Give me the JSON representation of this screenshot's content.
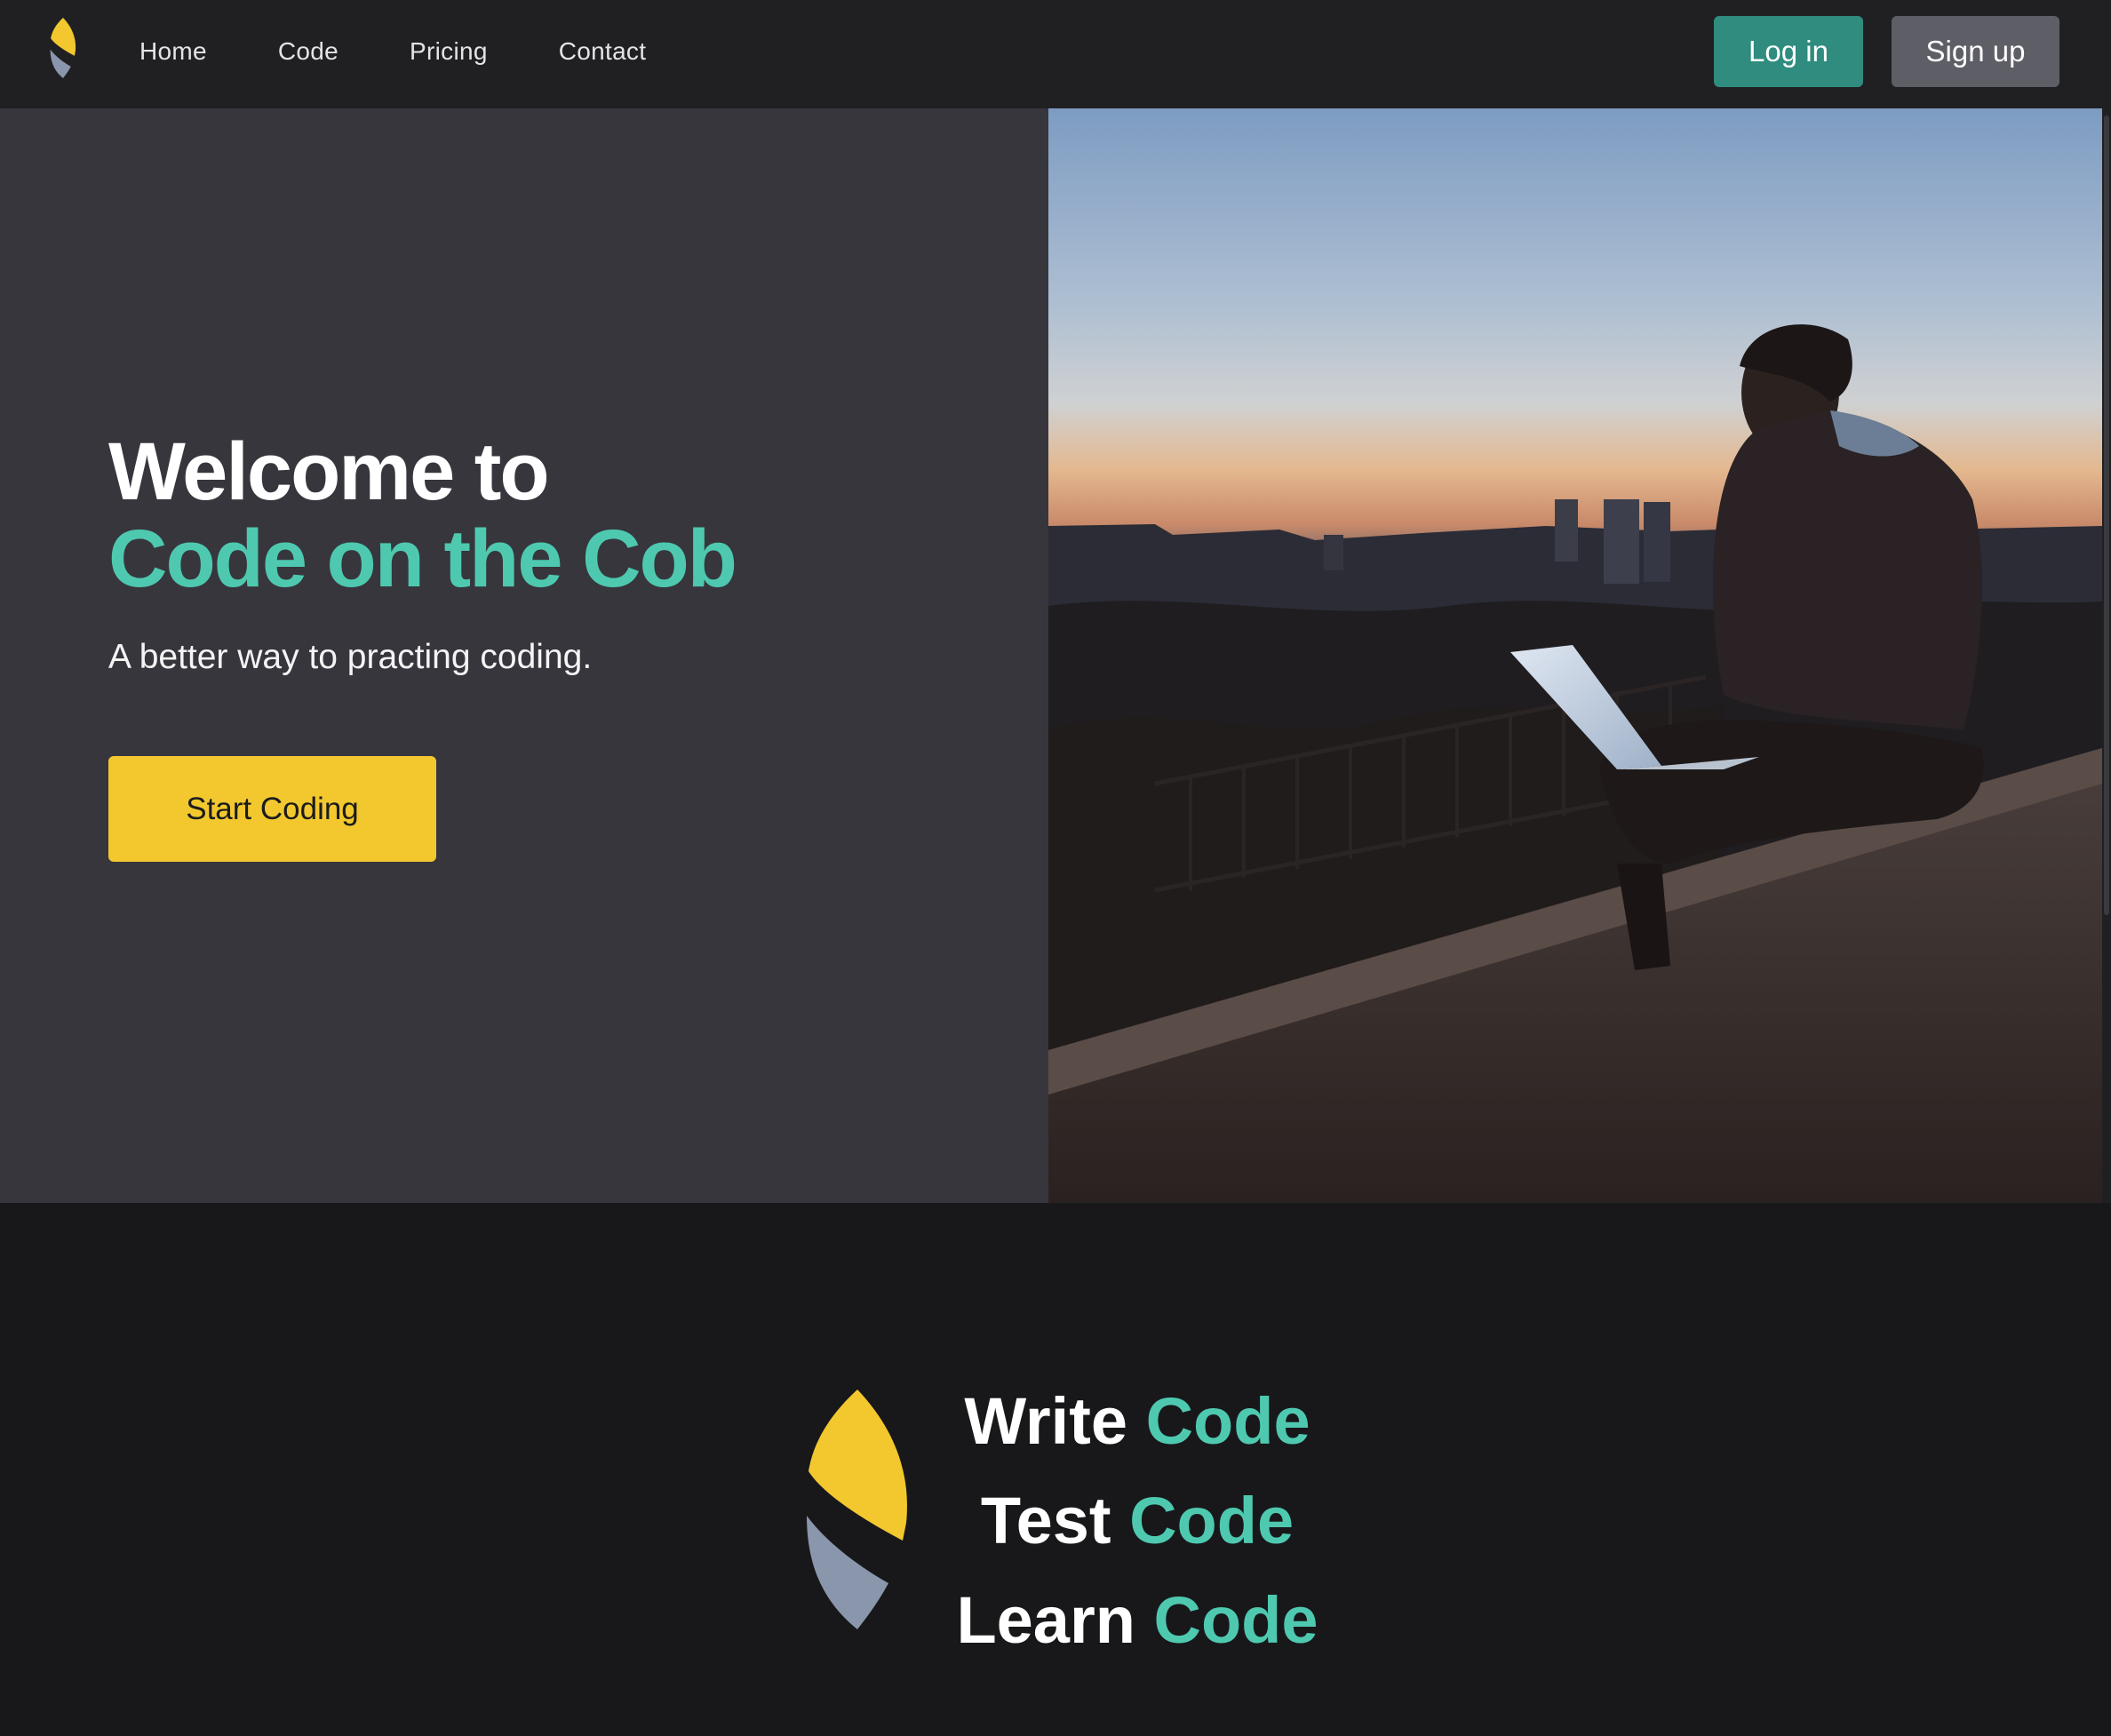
{
  "nav": {
    "links": [
      "Home",
      "Code",
      "Pricing",
      "Contact"
    ],
    "login_label": "Log in",
    "signup_label": "Sign up"
  },
  "hero": {
    "title_line1": "Welcome to",
    "title_line2": "Code on the Cob",
    "subtitle": "A better way to practing coding.",
    "cta_label": "Start Coding"
  },
  "features": {
    "lines": [
      {
        "verb": "Write",
        "noun": "Code"
      },
      {
        "verb": "Test",
        "noun": "Code"
      },
      {
        "verb": "Learn",
        "noun": "Code"
      }
    ]
  },
  "colors": {
    "accent": "#4ec9b0",
    "brand_yellow": "#f2c82e",
    "login_bg": "#2f8c7e",
    "signup_bg": "#5e5e66"
  },
  "icons": {
    "logo": "corn-leaf-logo-icon"
  }
}
